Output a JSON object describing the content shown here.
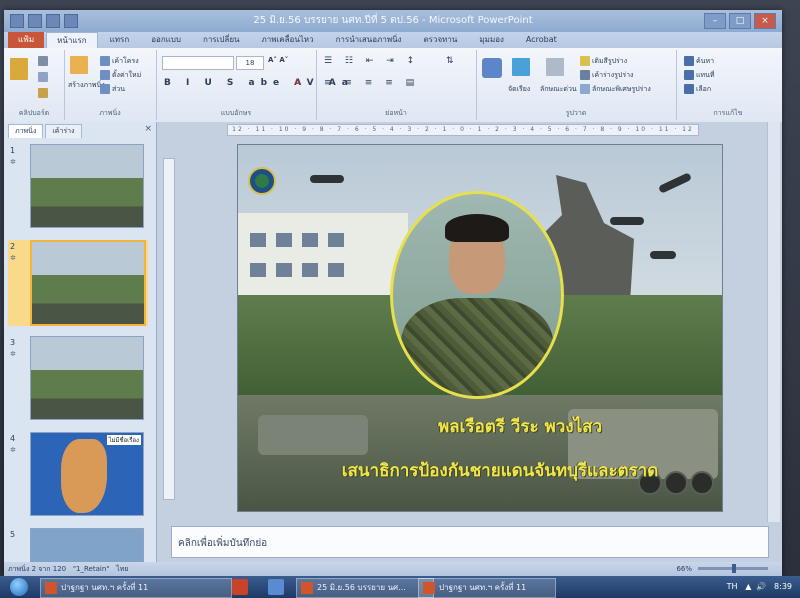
{
  "window": {
    "title": "25 มิ.ย.56 บรรยาย นศท.ปีที่ 5 ตป.56 - Microsoft PowerPoint"
  },
  "ribbon": {
    "tabs": [
      "แฟ้ม",
      "หน้าแรก",
      "แทรก",
      "ออกแบบ",
      "การเปลี่ยน",
      "ภาพเคลื่อนไหว",
      "การนำเสนอภาพนิ่ง",
      "ตรวจทาน",
      "มุมมอง",
      "Acrobat"
    ],
    "groups": {
      "clipboard": "คลิปบอร์ด",
      "slides": "ภาพนิ่ง",
      "font": "แบบอักษร",
      "paragraph": "ย่อหน้า",
      "drawing": "รูปวาด",
      "editing": "การแก้ไข"
    },
    "buttons": {
      "new_slide": "สร้างภาพนิ่ง",
      "layout": "เค้าโครง",
      "reset": "ตั้งค่าใหม่",
      "section": "ส่วน",
      "arrange": "จัดเรียง",
      "quick_styles": "ลักษณะด่วน",
      "shape_fill": "เติมสีรูปร่าง",
      "shape_outline": "เค้าร่างรูปร่าง",
      "shape_effects": "ลักษณะพิเศษรูปร่าง",
      "find": "ค้นหา",
      "replace": "แทนที่",
      "select": "เลือก"
    },
    "font_size": "18"
  },
  "left_pane": {
    "tabs": [
      "ภาพนิ่ง",
      "เค้าร่าง"
    ],
    "close": "×",
    "slides": [
      {
        "number": "1"
      },
      {
        "number": "2"
      },
      {
        "number": "3"
      },
      {
        "number": "4",
        "label": "ไม่มีชื่อเรื่อง"
      },
      {
        "number": "5"
      }
    ]
  },
  "slide": {
    "title_line1": "พลเรือตรี วีระ พวงไสว",
    "title_line2": "เสนาธิการป้องกันชายแดนจันทบุรีและตราด"
  },
  "ruler": {
    "text": "12 · 11 · 10 · 9 · 8 · 7 · 6 · 5 · 4 · 3 · 2 · 1 · 0 · 1 · 2 · 3 · 4 · 5 · 6 · 7 · 8 · 9 · 10 · 11 · 12"
  },
  "notes": {
    "placeholder": "คลิกเพื่อเพิ่มบันทึกย่อ"
  },
  "status": {
    "slide_info": "ภาพนิ่ง 2 จาก 120",
    "theme": "\"1_Retain\"",
    "language": "ไทย",
    "zoom": "66%"
  },
  "taskbar": {
    "items": [
      "25 มิ.ย.56 บรรยาย นศ...",
      "ปาฐกฐา นศท.ฯ ครั้งที่ 11"
    ],
    "left_item": "ปาฐกฐา นศท.ฯ ครั้งที่ 11",
    "lang": "TH",
    "time": "8:39"
  }
}
